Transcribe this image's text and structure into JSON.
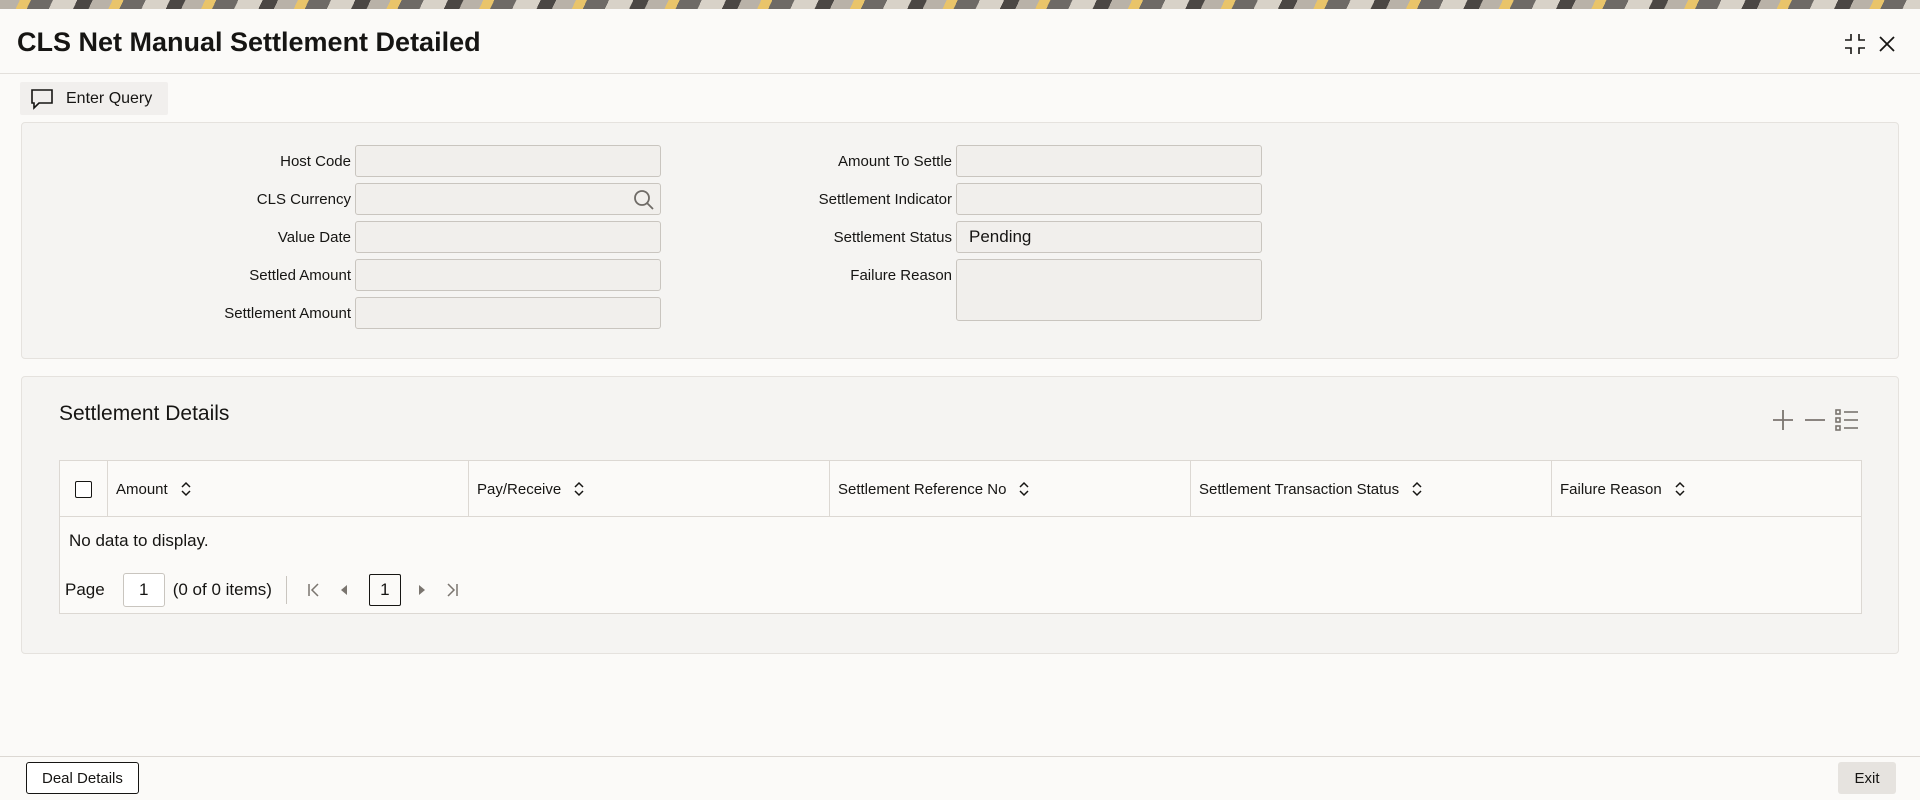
{
  "window": {
    "title": "CLS Net Manual Settlement Detailed"
  },
  "toolbar": {
    "enter_query_label": "Enter Query"
  },
  "form": {
    "host_code": {
      "label": "Host Code",
      "value": ""
    },
    "cls_currency": {
      "label": "CLS Currency",
      "value": ""
    },
    "value_date": {
      "label": "Value Date",
      "value": ""
    },
    "settled_amount": {
      "label": "Settled Amount",
      "value": ""
    },
    "settlement_amount": {
      "label": "Settlement Amount",
      "value": ""
    },
    "amount_to_settle": {
      "label": "Amount To Settle",
      "value": ""
    },
    "settlement_indicator": {
      "label": "Settlement Indicator",
      "value": ""
    },
    "settlement_status": {
      "label": "Settlement Status",
      "value": "Pending"
    },
    "failure_reason": {
      "label": "Failure Reason",
      "value": ""
    }
  },
  "settlement_details": {
    "title": "Settlement Details",
    "columns": [
      "Amount",
      "Pay/Receive",
      "Settlement Reference No",
      "Settlement Transaction Status",
      "Failure Reason"
    ],
    "empty_message": "No data to display.",
    "pager": {
      "page_label": "Page",
      "page_value": "1",
      "items_text": "(0 of 0 items)",
      "current_page": "1"
    }
  },
  "footer": {
    "deal_details_label": "Deal Details",
    "exit_label": "Exit"
  }
}
